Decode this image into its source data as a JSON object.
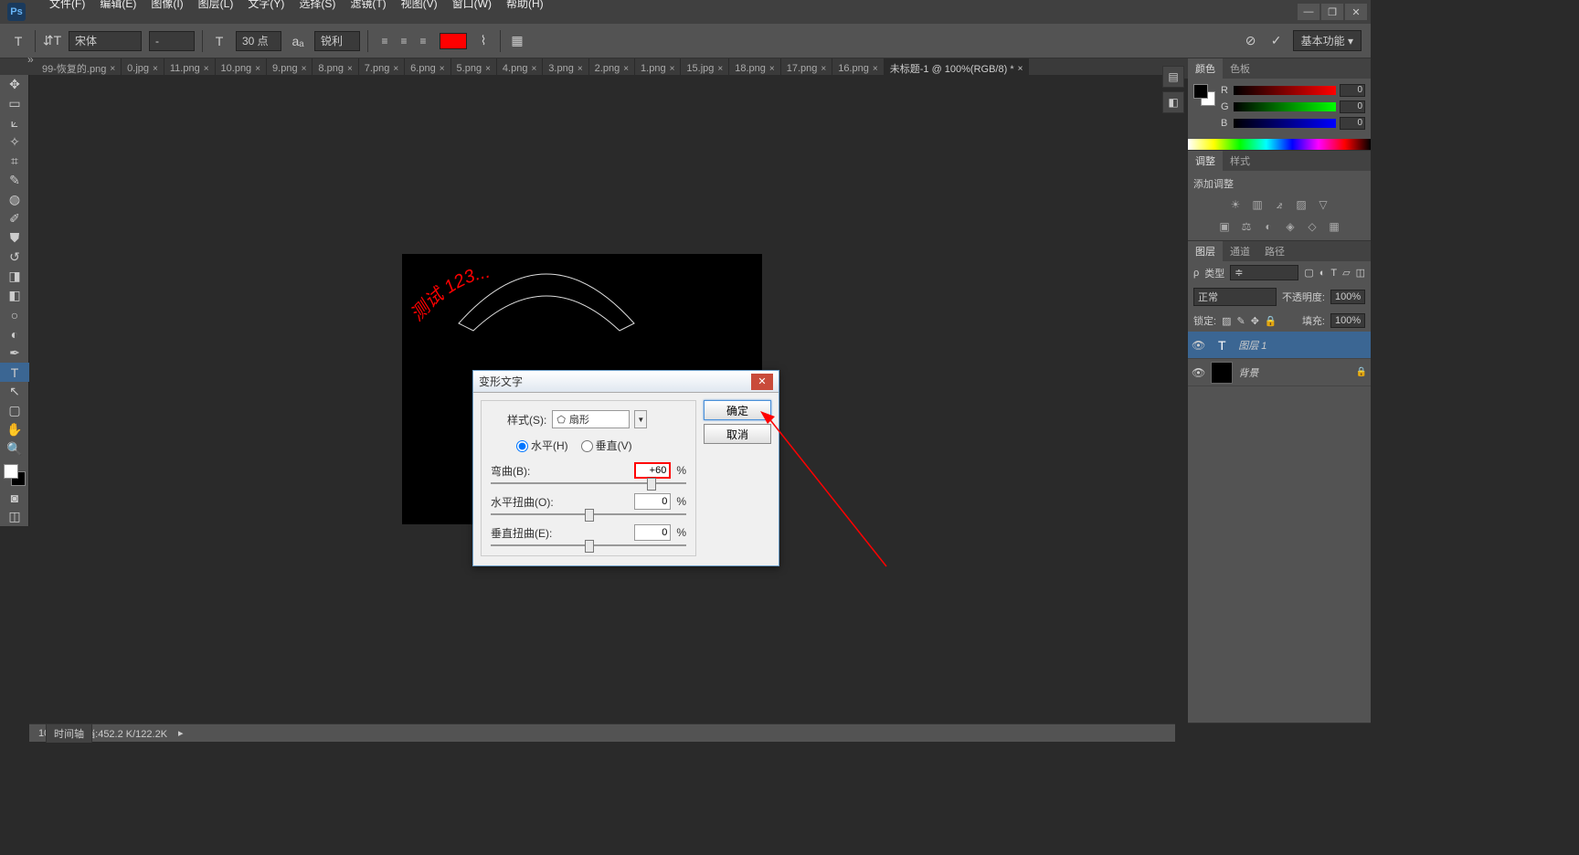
{
  "app": {
    "logo": "Ps"
  },
  "window_controls": {
    "minimize": "—",
    "restore": "❐",
    "close": "✕"
  },
  "menus": [
    "文件(F)",
    "编辑(E)",
    "图像(I)",
    "图层(L)",
    "文字(Y)",
    "选择(S)",
    "滤镜(T)",
    "视图(V)",
    "窗口(W)",
    "帮助(H)"
  ],
  "options_bar": {
    "font_family": "宋体",
    "font_style": "-",
    "font_size": "30 点",
    "aa": "锐利",
    "workspace": "基本功能"
  },
  "doc_tabs": {
    "double_arrow": "»",
    "items": [
      "99-恢复的.png",
      "0.jpg",
      "11.png",
      "10.png",
      "9.png",
      "8.png",
      "7.png",
      "6.png",
      "5.png",
      "4.png",
      "3.png",
      "2.png",
      "1.png",
      "15.jpg",
      "18.png",
      "17.png",
      "16.png",
      "未标题-1 @ 100%(RGB/8) *"
    ],
    "active_index": 17
  },
  "canvas_text": "测试 123...",
  "dialog": {
    "title": "变形文字",
    "style_label": "样式(S):",
    "style_value": "扇形",
    "horizontal": "水平(H)",
    "vertical": "垂直(V)",
    "bend_label": "弯曲(B):",
    "bend_value": "+60",
    "hdist_label": "水平扭曲(O):",
    "hdist_value": "0",
    "vdist_label": "垂直扭曲(E):",
    "vdist_value": "0",
    "percent": "%",
    "ok": "确定",
    "cancel": "取消"
  },
  "panels": {
    "color": {
      "tabs": [
        "颜色",
        "色板"
      ],
      "r_label": "R",
      "g_label": "G",
      "b_label": "B",
      "r": "0",
      "g": "0",
      "b": "0"
    },
    "adjustments": {
      "tabs": [
        "调整",
        "样式"
      ],
      "text": "添加调整"
    },
    "layers": {
      "tabs": [
        "图层",
        "通道",
        "路径"
      ],
      "kind_label": "类型",
      "blend_mode": "正常",
      "opacity_label": "不透明度:",
      "opacity": "100%",
      "lock_label": "锁定:",
      "fill_label": "填充:",
      "fill": "100%",
      "items": [
        {
          "name": "图层 1",
          "type": "text"
        },
        {
          "name": "背景",
          "type": "bg",
          "locked": true
        }
      ]
    }
  },
  "statusbar": {
    "zoom": "100%",
    "doc_info": "文档:452.2 K/122.2K",
    "timeline": "时间轴"
  }
}
